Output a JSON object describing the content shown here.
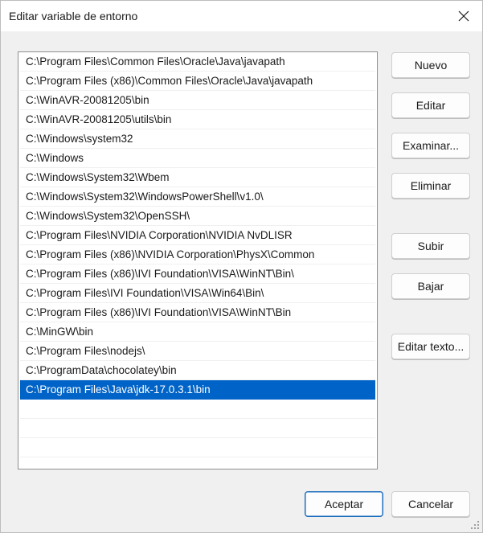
{
  "window": {
    "title": "Editar variable de entorno"
  },
  "list": {
    "items": [
      "C:\\Program Files\\Common Files\\Oracle\\Java\\javapath",
      "C:\\Program Files (x86)\\Common Files\\Oracle\\Java\\javapath",
      "C:\\WinAVR-20081205\\bin",
      "C:\\WinAVR-20081205\\utils\\bin",
      "C:\\Windows\\system32",
      "C:\\Windows",
      "C:\\Windows\\System32\\Wbem",
      "C:\\Windows\\System32\\WindowsPowerShell\\v1.0\\",
      "C:\\Windows\\System32\\OpenSSH\\",
      "C:\\Program Files\\NVIDIA Corporation\\NVIDIA NvDLISR",
      "C:\\Program Files (x86)\\NVIDIA Corporation\\PhysX\\Common",
      "C:\\Program Files (x86)\\IVI Foundation\\VISA\\WinNT\\Bin\\",
      "C:\\Program Files\\IVI Foundation\\VISA\\Win64\\Bin\\",
      "C:\\Program Files (x86)\\IVI Foundation\\VISA\\WinNT\\Bin",
      "C:\\MinGW\\bin",
      "C:\\Program Files\\nodejs\\",
      "C:\\ProgramData\\chocolatey\\bin",
      "C:\\Program Files\\Java\\jdk-17.0.3.1\\bin"
    ],
    "selected_index": 17,
    "empty_rows": 4
  },
  "buttons": {
    "nuevo": "Nuevo",
    "editar": "Editar",
    "examinar": "Examinar...",
    "eliminar": "Eliminar",
    "subir": "Subir",
    "bajar": "Bajar",
    "editar_texto": "Editar texto...",
    "aceptar": "Aceptar",
    "cancelar": "Cancelar"
  },
  "colors": {
    "selection": "#0063c7",
    "primary_border": "#1f6fbd"
  }
}
